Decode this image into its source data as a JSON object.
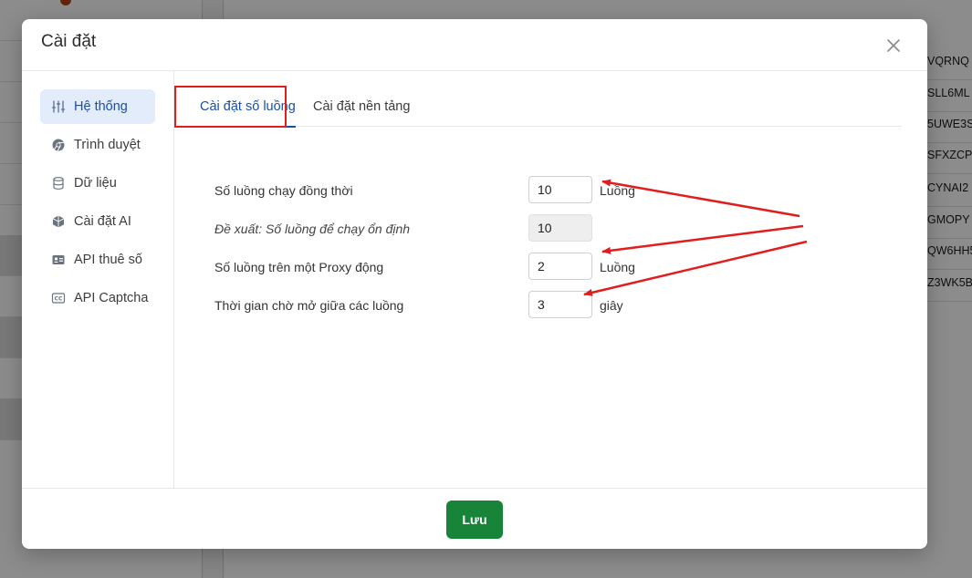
{
  "background": {
    "cells": [
      "VQRNQ",
      "SLL6ML",
      "5UWE3S",
      "SFXZCP",
      "CYNAI2",
      "GMOPY",
      "QW6HH5",
      "Z3WK5B"
    ]
  },
  "modal": {
    "title": "Cài đặt",
    "close_icon": "close-icon"
  },
  "sidebar": {
    "items": [
      {
        "label": "Hệ thống",
        "icon": "sliders-icon",
        "active": true
      },
      {
        "label": "Trình duyệt",
        "icon": "chrome-icon",
        "active": false
      },
      {
        "label": "Dữ liệu",
        "icon": "database-icon",
        "active": false
      },
      {
        "label": "Cài đặt AI",
        "icon": "ai-cube-icon",
        "active": false
      },
      {
        "label": "API thuê số",
        "icon": "id-card-icon",
        "active": false
      },
      {
        "label": "API Captcha",
        "icon": "cc-icon",
        "active": false
      }
    ]
  },
  "tabs": [
    {
      "label": "Cài đặt số luồng",
      "active": true
    },
    {
      "label": "Cài đặt nền tảng",
      "active": false
    }
  ],
  "form": {
    "rows": [
      {
        "label": "Số luồng chạy đồng thời",
        "value": "10",
        "unit": "Luồng",
        "italic": false,
        "readonly": false
      },
      {
        "label": "Đề xuất: Số luồng để chạy ổn định",
        "value": "10",
        "unit": "",
        "italic": true,
        "readonly": true
      },
      {
        "label": "Số luồng trên một Proxy động",
        "value": "2",
        "unit": "Luồng",
        "italic": false,
        "readonly": false
      },
      {
        "label": "Thời gian chờ mở giữa các luồng",
        "value": "3",
        "unit": "giây",
        "italic": false,
        "readonly": false
      }
    ]
  },
  "footer": {
    "save_label": "Lưu"
  },
  "colors": {
    "accent": "#1a4fa8",
    "active_bg": "#e3ecfb",
    "save_button": "#18843a",
    "annotation": "#e11d1d"
  }
}
